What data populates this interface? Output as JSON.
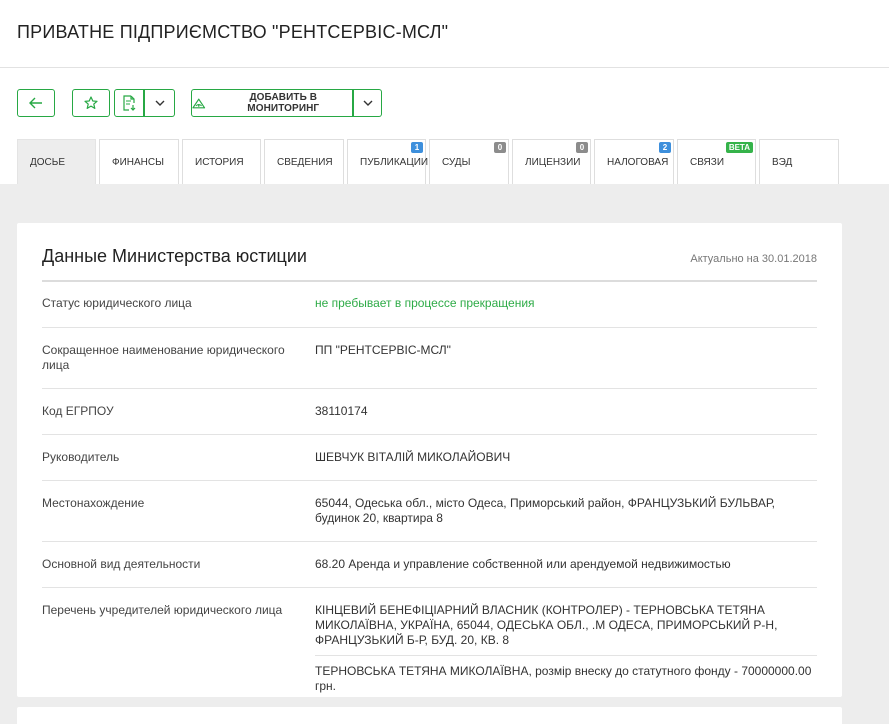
{
  "header": {
    "title": "ПРИВАТНЕ ПІДПРИЄМСТВО \"РЕНТСЕРВІС-МСЛ\""
  },
  "toolbar": {
    "back_icon": "arrow-left-icon",
    "favorite_icon": "star-icon",
    "export_icon": "document-download-icon",
    "monitor_label": "ДОБАВИТЬ В МОНИТОРИНГ",
    "monitor_icon": "monitoring-icon",
    "accent": "#27a844"
  },
  "tabs": [
    {
      "label": "ДОСЬЕ",
      "badge": ""
    },
    {
      "label": "ФИНАНСЫ",
      "badge": ""
    },
    {
      "label": "ИСТОРИЯ",
      "badge": ""
    },
    {
      "label": "СВЕДЕНИЯ",
      "badge": ""
    },
    {
      "label": "ПУБЛИКАЦИИ",
      "badge": "1"
    },
    {
      "label": "СУДЫ",
      "badge": "0"
    },
    {
      "label": "ЛИЦЕНЗИИ",
      "badge": "0"
    },
    {
      "label": "НАЛОГОВАЯ",
      "badge": "2"
    },
    {
      "label": "СВЯЗИ",
      "badge": "beta"
    },
    {
      "label": "ВЭД",
      "badge": ""
    }
  ],
  "card": {
    "title": "Данные Министерства юстиции",
    "date": "Актуально на 30.01.2018",
    "rows": [
      {
        "label": "Статус юридического лица",
        "value": "не пребывает в процессе прекращения"
      },
      {
        "label": "Сокращенное наименование юридического лица",
        "value": "ПП \"РЕНТСЕРВІС-МСЛ\""
      },
      {
        "label": "Код ЕГРПОУ",
        "value": "38110174"
      },
      {
        "label": "Руководитель",
        "value": "ШЕВЧУК ВІТАЛІЙ МИКОЛАЙОВИЧ"
      },
      {
        "label": "Местонахождение",
        "value": "65044, Одеська обл., місто Одеса, Приморський район, ФРАНЦУЗЬКИЙ БУЛЬВАР, будинок 20, квартира 8"
      },
      {
        "label": "Основной вид деятельности",
        "value": "68.20 Аренда и управление собственной или арендуемой недвижимостью"
      },
      {
        "label": "Перечень учредителей юридического лица",
        "values": [
          "КІНЦЕВИЙ БЕНЕФІЦІАРНИЙ ВЛАСНИК (КОНТРОЛЕР) - ТЕРНОВСЬКА ТЕТЯНА МИКОЛАЇВНА, УКРАЇНА, 65044, ОДЕСЬКА ОБЛ., .М ОДЕСА, ПРИМОРСЬКИЙ Р-Н, ФРАНЦУЗЬКИЙ Б-Р, БУД. 20, КВ. 8",
          "ТЕРНОВСЬКА ТЕТЯНА МИКОЛАЇВНА, розмір внеску до статутного фонду - 70000000.00 грн."
        ]
      }
    ]
  }
}
